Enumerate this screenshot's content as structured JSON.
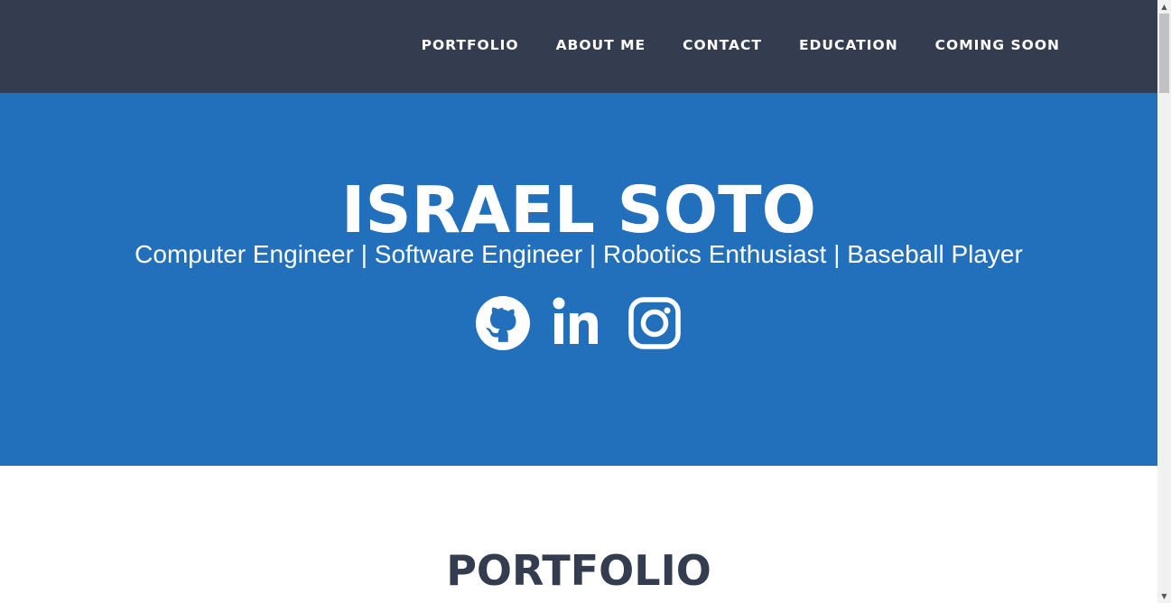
{
  "nav": {
    "items": [
      {
        "label": "PORTFOLIO"
      },
      {
        "label": "ABOUT ME"
      },
      {
        "label": "CONTACT"
      },
      {
        "label": "EDUCATION"
      },
      {
        "label": "COMING SOON"
      }
    ]
  },
  "hero": {
    "name": "ISRAEL SOTO",
    "subtitle": "Computer Engineer | Software Engineer | Robotics Enthusiast | Baseball Player",
    "social": [
      {
        "icon": "github-icon"
      },
      {
        "icon": "linkedin-icon"
      },
      {
        "icon": "instagram-icon"
      }
    ]
  },
  "sections": {
    "portfolio_title": "PORTFOLIO"
  },
  "colors": {
    "navbar": "#333d4f",
    "hero": "#226fbb",
    "heading": "#333d4f",
    "text_on_dark": "#ffffff"
  }
}
